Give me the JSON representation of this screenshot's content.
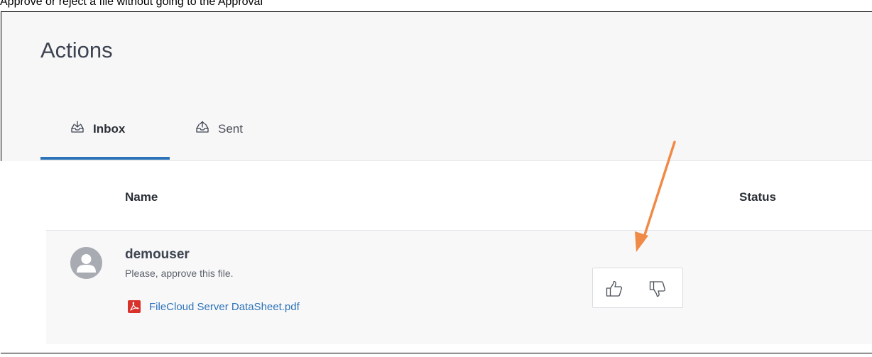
{
  "caption": "Approve or reject a file without going to the Approval",
  "page": {
    "title": "Actions"
  },
  "tabs": [
    {
      "label": "Inbox",
      "active": true,
      "icon": "inbox-download-icon"
    },
    {
      "label": "Sent",
      "active": false,
      "icon": "inbox-upload-icon"
    }
  ],
  "table": {
    "columns": {
      "name": "Name",
      "status": "Status"
    },
    "rows": [
      {
        "user": "demouser",
        "message": "Please, approve this file.",
        "file": "FileCloud Server DataSheet.pdf",
        "file_icon": "pdf-icon",
        "actions": [
          "thumbs-up-icon",
          "thumbs-down-icon"
        ]
      }
    ]
  },
  "colors": {
    "accent": "#2d73b8",
    "arrow": "#f08a47",
    "pdf": "#d9322b",
    "avatar": "#a8abb1"
  }
}
